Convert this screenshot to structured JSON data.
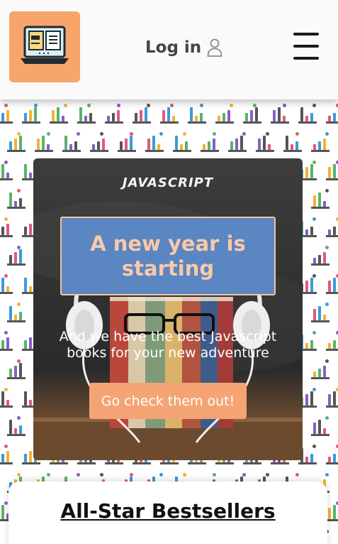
{
  "header": {
    "logo_icon": "laptop-book-icon",
    "login_label": "Log in",
    "login_icon": "user-icon",
    "menu_icon": "hamburger-menu-icon"
  },
  "hero": {
    "brand": "JAVASCRIPT",
    "title": "A new year is starting",
    "subtitle": "And we have the best Javascript books for your new adventure",
    "cta_label": "Go check them out!"
  },
  "bestsellers": {
    "heading": "All-Star Bestsellers"
  },
  "colors": {
    "accent": "#f4a474",
    "title_box": "#5a86c2",
    "title_text": "#f9c9a8"
  }
}
